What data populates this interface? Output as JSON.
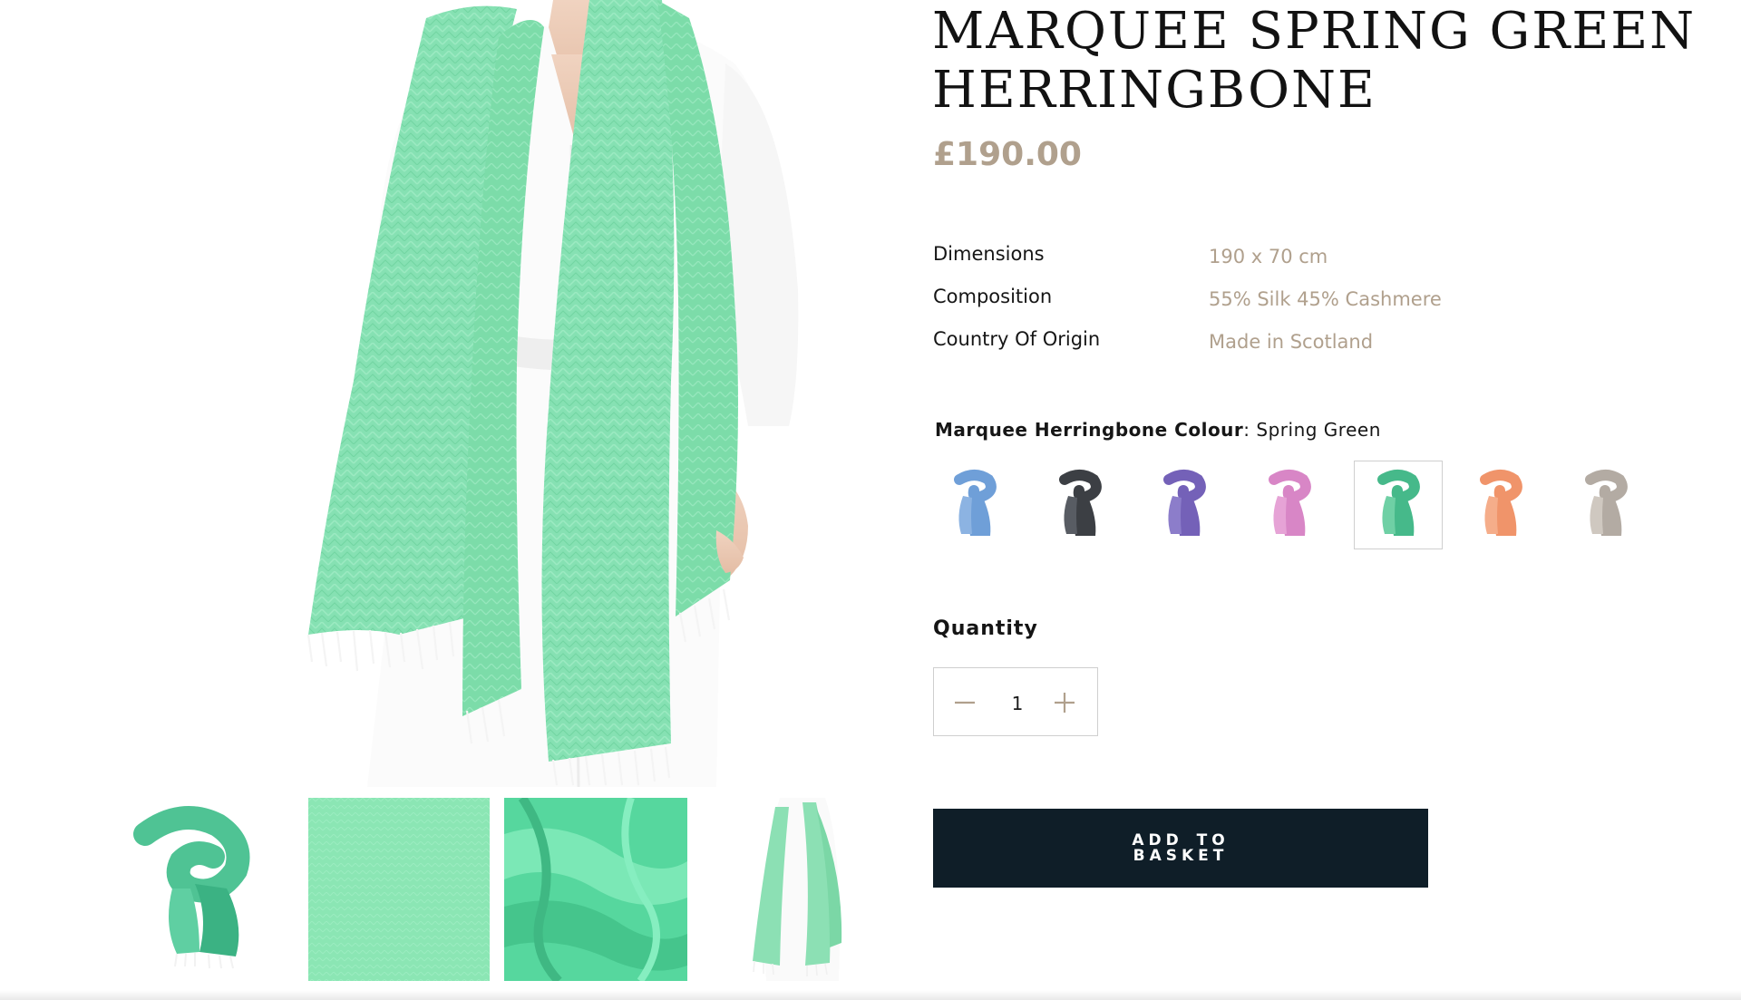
{
  "product": {
    "title": "MARQUEE SPRING GREEN HERRINGBONE",
    "price": "£190.00",
    "image_description": "Model wearing spring green herringbone scarf over white shirt dress"
  },
  "specs": [
    {
      "label": "Dimensions",
      "value": "190 x 70 cm"
    },
    {
      "label": "Composition",
      "value": "55% Silk 45% Cashmere"
    },
    {
      "label": "Country Of Origin",
      "value": "Made in Scotland"
    }
  ],
  "colour": {
    "label": "Marquee Herringbone Colour",
    "selected": "Spring Green",
    "swatches": [
      {
        "name": "sky-blue",
        "color": "#6f9fd8",
        "selected": false
      },
      {
        "name": "charcoal",
        "color": "#3c3f44",
        "selected": false
      },
      {
        "name": "purple",
        "color": "#7461b8",
        "selected": false
      },
      {
        "name": "pink",
        "color": "#d886c6",
        "selected": false
      },
      {
        "name": "spring-green",
        "color": "#46b98a",
        "selected": true
      },
      {
        "name": "orange",
        "color": "#f0946a",
        "selected": false
      },
      {
        "name": "taupe",
        "color": "#b3aba3",
        "selected": false
      }
    ]
  },
  "quantity": {
    "label": "Quantity",
    "value": "1"
  },
  "actions": {
    "add_to_basket": "ADD TO BASKET"
  },
  "thumbnails": [
    {
      "name": "folded-scarf",
      "color": "#58c99c"
    },
    {
      "name": "fabric-texture",
      "color": "#8be6b4"
    },
    {
      "name": "fabric-drape",
      "color": "#56d79e"
    },
    {
      "name": "model-wearing",
      "color": "#8ce0b4"
    }
  ],
  "colors": {
    "accent_tan": "#b0a08d",
    "button_navy": "#0f1e28",
    "scarf_green": "#84e0b0"
  }
}
